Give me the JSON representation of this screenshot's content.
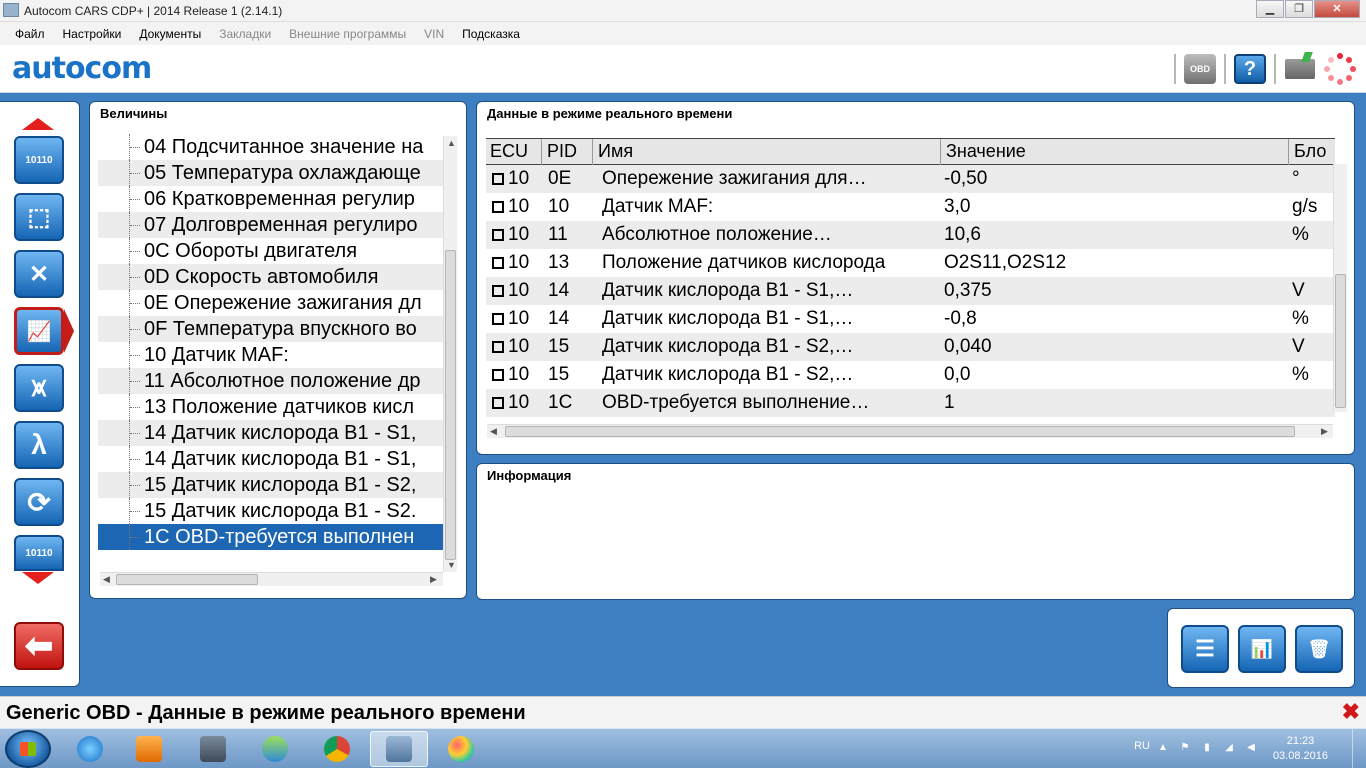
{
  "window": {
    "title": "Autocom CARS CDP+ | 2014 Release 1 (2.14.1)",
    "controls": [
      "minimize",
      "restore",
      "close"
    ]
  },
  "menu": [
    {
      "label": "Файл",
      "enabled": true
    },
    {
      "label": "Настройки",
      "enabled": true
    },
    {
      "label": "Документы",
      "enabled": true
    },
    {
      "label": "Закладки",
      "enabled": false
    },
    {
      "label": "Внешние программы",
      "enabled": false
    },
    {
      "label": "VIN",
      "enabled": false
    },
    {
      "label": "Подсказка",
      "enabled": true
    }
  ],
  "header": {
    "logo": "autocom",
    "obd_label": "OBD",
    "help_label": "?",
    "icons": [
      "obd-regulation-icon",
      "help-icon",
      "battery-icon",
      "connection-spinner-icon"
    ]
  },
  "leftnav": {
    "buttons": [
      {
        "name": "nav-info-button",
        "glyph": "10110",
        "active": false
      },
      {
        "name": "nav-engine-button",
        "glyph": "⬚",
        "active": false
      },
      {
        "name": "nav-clear-engine-button",
        "glyph": "✕",
        "active": false
      },
      {
        "name": "nav-live-data-button",
        "glyph": "📈",
        "active": true
      },
      {
        "name": "nav-freeze-frame-button",
        "glyph": "⩙",
        "active": false
      },
      {
        "name": "nav-lambda-button",
        "glyph": "λ",
        "active": false
      },
      {
        "name": "nav-readiness-button",
        "glyph": "⟳",
        "active": false
      },
      {
        "name": "nav-dtc-button",
        "glyph": "10110",
        "active": false
      }
    ],
    "back_glyph": "⬅"
  },
  "values_panel": {
    "title": "Величины",
    "items": [
      {
        "label": "04 Подсчитанное значение на",
        "alt": false
      },
      {
        "label": "05 Температура охлаждающе",
        "alt": true
      },
      {
        "label": "06 Кратковременная регулир",
        "alt": false
      },
      {
        "label": "07 Долговременная регулиро",
        "alt": true
      },
      {
        "label": "0C Обороты двигателя",
        "alt": false
      },
      {
        "label": "0D Скорость автомобиля",
        "alt": true
      },
      {
        "label": "0E Опережение зажигания дл",
        "alt": false
      },
      {
        "label": "0F Температура впускного во",
        "alt": true
      },
      {
        "label": "10 Датчик MAF:",
        "alt": false
      },
      {
        "label": "11 Абсолютное положение др",
        "alt": true
      },
      {
        "label": "13 Положение датчиков кисл",
        "alt": false
      },
      {
        "label": "14 Датчик кислорода B1 - S1,",
        "alt": true
      },
      {
        "label": "14 Датчик кислорода B1 - S1,",
        "alt": false
      },
      {
        "label": "15 Датчик кислорода B1 - S2,",
        "alt": true
      },
      {
        "label": "15 Датчик кислорода B1 - S2.",
        "alt": false
      },
      {
        "label": "1C OBD-требуется выполнен",
        "alt": false,
        "selected": true
      }
    ]
  },
  "live_panel": {
    "title": "Данные в режиме реального времени",
    "columns": [
      "ECU",
      "PID",
      "Имя",
      "Значение",
      "Бло"
    ],
    "rows": [
      {
        "ecu": "10",
        "pid": "0E",
        "name": "Опережение  зажигания  для…",
        "value": "-0,50",
        "unit": "°"
      },
      {
        "ecu": "10",
        "pid": "10",
        "name": "Датчик MAF:",
        "value": "3,0",
        "unit": "g/s"
      },
      {
        "ecu": "10",
        "pid": "11",
        "name": "Абсолютное  положение…",
        "value": "10,6",
        "unit": "%"
      },
      {
        "ecu": "10",
        "pid": "13",
        "name": "Положение датчиков кислорода",
        "value": "O2S11,O2S12",
        "unit": ""
      },
      {
        "ecu": "10",
        "pid": "14",
        "name": "Датчик кислорода B1 - S1,…",
        "value": "0,375",
        "unit": "V"
      },
      {
        "ecu": "10",
        "pid": "14",
        "name": "Датчик кислорода B1 - S1,…",
        "value": "-0,8",
        "unit": "%"
      },
      {
        "ecu": "10",
        "pid": "15",
        "name": "Датчик кислорода B1 - S2,…",
        "value": "0,040",
        "unit": "V"
      },
      {
        "ecu": "10",
        "pid": "15",
        "name": "Датчик кислорода B1 - S2,…",
        "value": "0,0",
        "unit": "%"
      },
      {
        "ecu": "10",
        "pid": "1C",
        "name": "OBD-требуется  выполнение…",
        "value": "1",
        "unit": ""
      }
    ]
  },
  "info_panel": {
    "title": "Информация",
    "text": ""
  },
  "actions": [
    {
      "name": "list-view-button",
      "glyph": "☰"
    },
    {
      "name": "graph-view-button",
      "glyph": "📊"
    },
    {
      "name": "clear-values-button",
      "glyph": "🗑"
    }
  ],
  "statusbar": {
    "text": "Generic OBD - Данные в режиме реального времени",
    "close_glyph": "✖"
  },
  "taskbar": {
    "apps": [
      "internet-explorer",
      "media-player",
      "mouse-utility",
      "network-users",
      "chrome",
      "autocom",
      "paint"
    ],
    "active_app": "autocom",
    "language": "RU",
    "time": "21:23",
    "date": "03.08.2016"
  }
}
